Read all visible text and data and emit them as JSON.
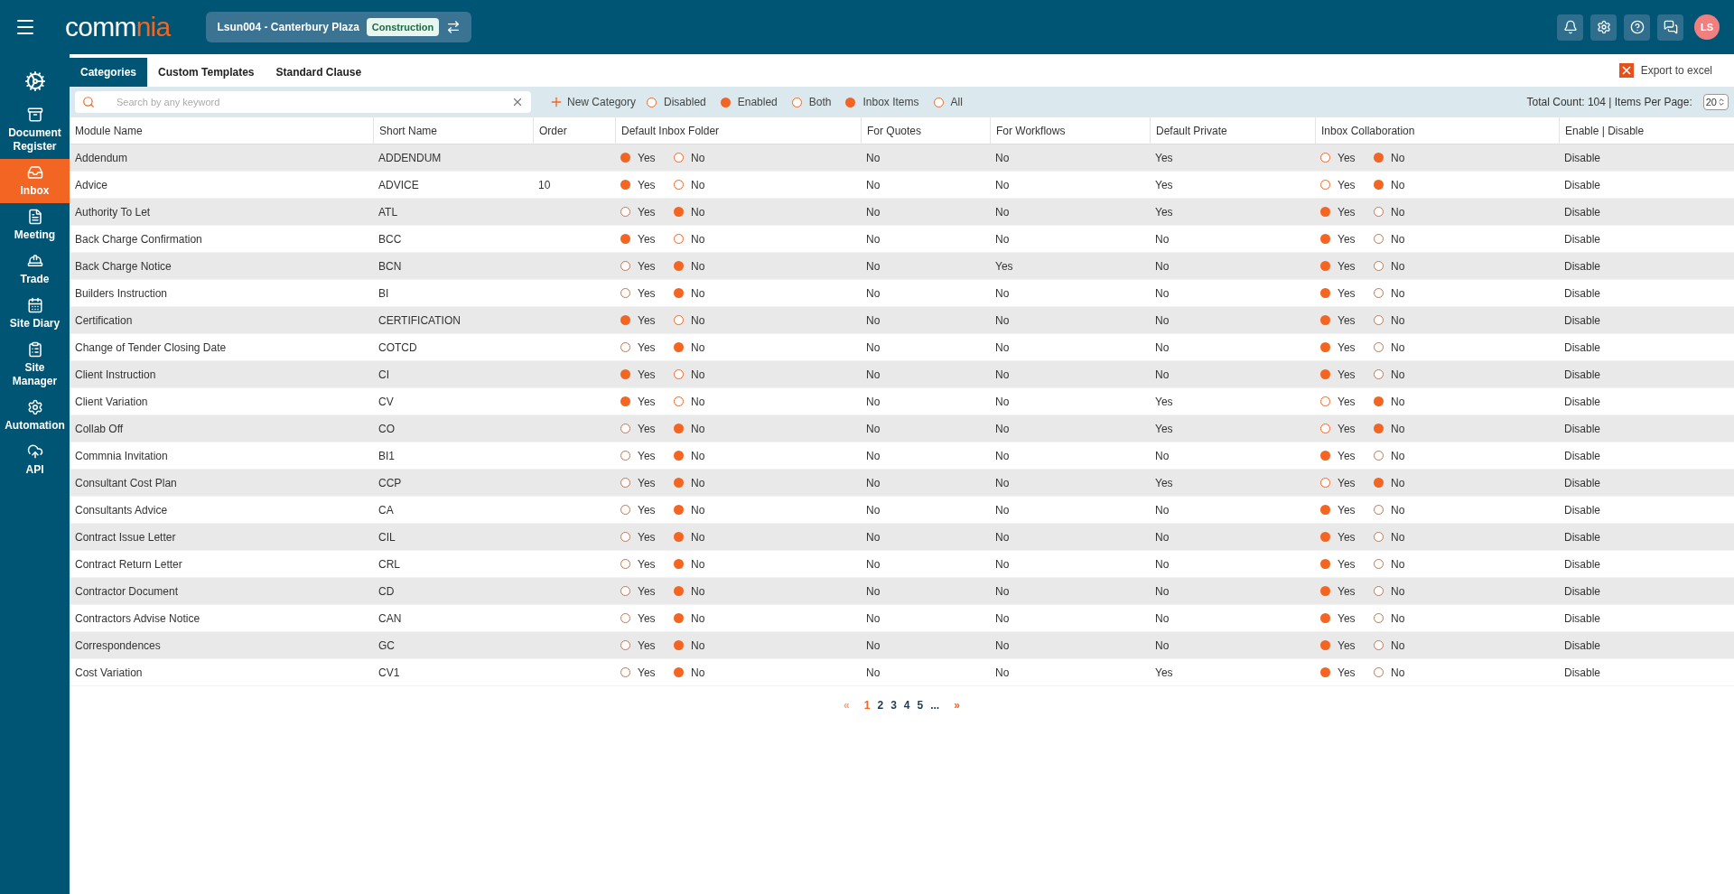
{
  "header": {
    "logo": {
      "main": "comm",
      "accent": "nia"
    },
    "project": {
      "name": "Lsun004 - Canterbury Plaza",
      "badge": "Construction"
    },
    "avatar": "LS"
  },
  "sidebar": {
    "items": [
      {
        "selected": false
      },
      {
        "label": "Document Register",
        "selected": false
      },
      {
        "label": "Inbox",
        "selected": true
      },
      {
        "label": "Meeting",
        "selected": false
      },
      {
        "label": "Trade",
        "selected": false
      },
      {
        "label": "Site Diary",
        "selected": false
      },
      {
        "label": "Site Manager",
        "selected": false
      },
      {
        "label": "Automation",
        "selected": false
      },
      {
        "label": "API",
        "selected": false
      }
    ]
  },
  "tabs": [
    {
      "label": "Categories",
      "selected": true
    },
    {
      "label": "Custom Templates",
      "selected": false
    },
    {
      "label": "Standard Clause",
      "selected": false
    }
  ],
  "export": "Export to excel",
  "search": {
    "placeholder": "Search by any keyword"
  },
  "new_category": "New Category",
  "filters": [
    [
      {
        "label": "Disabled",
        "selected": false
      },
      {
        "label": "Enabled",
        "selected": true
      },
      {
        "label": "Both",
        "selected": false
      }
    ],
    [
      {
        "label": "Inbox Items",
        "selected": true
      },
      {
        "label": "All",
        "selected": false
      }
    ]
  ],
  "total": "Total Count: 104 | Items Per Page:",
  "per_page": "20",
  "table": {
    "columns": [
      "Module Name",
      "Short Name",
      "Order",
      "Default Inbox Folder",
      "For Quotes",
      "For Workflows",
      "Default Private",
      "Inbox Collaboration",
      "Enable | Disable"
    ],
    "rows": [
      {
        "name": "Addendum",
        "short": "ADDENDUM",
        "inbox": [
          {
            "label": "Yes",
            "selected": true
          },
          {
            "label": "No",
            "selected": false
          }
        ],
        "quotes": "No",
        "workflows": "No",
        "private": "Yes",
        "collab": [
          {
            "label": "Yes",
            "selected": false
          },
          {
            "label": "No",
            "selected": true
          }
        ],
        "action": "Disable"
      },
      {
        "name": "Advice",
        "short": "ADVICE",
        "order": "10",
        "inbox": [
          {
            "label": "Yes",
            "selected": true
          },
          {
            "label": "No",
            "selected": false
          }
        ],
        "quotes": "No",
        "workflows": "No",
        "private": "Yes",
        "collab": [
          {
            "label": "Yes",
            "selected": false
          },
          {
            "label": "No",
            "selected": true
          }
        ],
        "action": "Disable"
      },
      {
        "name": "Authority To Let",
        "short": "ATL",
        "inbox": [
          {
            "label": "Yes",
            "selected": false
          },
          {
            "label": "No",
            "selected": true
          }
        ],
        "quotes": "No",
        "workflows": "No",
        "private": "Yes",
        "collab": [
          {
            "label": "Yes",
            "selected": true
          },
          {
            "label": "No",
            "selected": false
          }
        ],
        "action": "Disable"
      },
      {
        "name": "Back Charge Confirmation",
        "short": "BCC",
        "inbox": [
          {
            "label": "Yes",
            "selected": true
          },
          {
            "label": "No",
            "selected": false
          }
        ],
        "quotes": "No",
        "workflows": "No",
        "private": "No",
        "collab": [
          {
            "label": "Yes",
            "selected": true
          },
          {
            "label": "No",
            "selected": false
          }
        ],
        "action": "Disable"
      },
      {
        "name": "Back Charge Notice",
        "short": "BCN",
        "inbox": [
          {
            "label": "Yes",
            "selected": false
          },
          {
            "label": "No",
            "selected": true
          }
        ],
        "quotes": "No",
        "workflows": "Yes",
        "private": "No",
        "collab": [
          {
            "label": "Yes",
            "selected": true
          },
          {
            "label": "No",
            "selected": false
          }
        ],
        "action": "Disable"
      },
      {
        "name": "Builders Instruction",
        "short": "BI",
        "inbox": [
          {
            "label": "Yes",
            "selected": false
          },
          {
            "label": "No",
            "selected": true
          }
        ],
        "quotes": "No",
        "workflows": "No",
        "private": "No",
        "collab": [
          {
            "label": "Yes",
            "selected": true
          },
          {
            "label": "No",
            "selected": false
          }
        ],
        "action": "Disable"
      },
      {
        "name": "Certification",
        "short": "CERTIFICATION",
        "inbox": [
          {
            "label": "Yes",
            "selected": true
          },
          {
            "label": "No",
            "selected": false
          }
        ],
        "quotes": "No",
        "workflows": "No",
        "private": "No",
        "collab": [
          {
            "label": "Yes",
            "selected": true
          },
          {
            "label": "No",
            "selected": false
          }
        ],
        "action": "Disable"
      },
      {
        "name": "Change of Tender Closing Date",
        "short": "COTCD",
        "inbox": [
          {
            "label": "Yes",
            "selected": false
          },
          {
            "label": "No",
            "selected": true
          }
        ],
        "quotes": "No",
        "workflows": "No",
        "private": "No",
        "collab": [
          {
            "label": "Yes",
            "selected": true
          },
          {
            "label": "No",
            "selected": false
          }
        ],
        "action": "Disable"
      },
      {
        "name": "Client Instruction",
        "short": "CI",
        "inbox": [
          {
            "label": "Yes",
            "selected": true
          },
          {
            "label": "No",
            "selected": false
          }
        ],
        "quotes": "No",
        "workflows": "No",
        "private": "No",
        "collab": [
          {
            "label": "Yes",
            "selected": true
          },
          {
            "label": "No",
            "selected": false
          }
        ],
        "action": "Disable"
      },
      {
        "name": "Client Variation",
        "short": "CV",
        "inbox": [
          {
            "label": "Yes",
            "selected": true
          },
          {
            "label": "No",
            "selected": false
          }
        ],
        "quotes": "No",
        "workflows": "No",
        "private": "Yes",
        "collab": [
          {
            "label": "Yes",
            "selected": false
          },
          {
            "label": "No",
            "selected": true
          }
        ],
        "action": "Disable"
      },
      {
        "name": "Collab Off",
        "short": "CO",
        "inbox": [
          {
            "label": "Yes",
            "selected": false
          },
          {
            "label": "No",
            "selected": true
          }
        ],
        "quotes": "No",
        "workflows": "No",
        "private": "Yes",
        "collab": [
          {
            "label": "Yes",
            "selected": false
          },
          {
            "label": "No",
            "selected": true
          }
        ],
        "action": "Disable"
      },
      {
        "name": "Commnia Invitation",
        "short": "BI1",
        "inbox": [
          {
            "label": "Yes",
            "selected": false
          },
          {
            "label": "No",
            "selected": true
          }
        ],
        "quotes": "No",
        "workflows": "No",
        "private": "No",
        "collab": [
          {
            "label": "Yes",
            "selected": true
          },
          {
            "label": "No",
            "selected": false
          }
        ],
        "action": "Disable"
      },
      {
        "name": "Consultant Cost Plan",
        "short": "CCP",
        "inbox": [
          {
            "label": "Yes",
            "selected": false
          },
          {
            "label": "No",
            "selected": true
          }
        ],
        "quotes": "No",
        "workflows": "No",
        "private": "Yes",
        "collab": [
          {
            "label": "Yes",
            "selected": false
          },
          {
            "label": "No",
            "selected": true
          }
        ],
        "action": "Disable"
      },
      {
        "name": "Consultants Advice",
        "short": "CA",
        "inbox": [
          {
            "label": "Yes",
            "selected": false
          },
          {
            "label": "No",
            "selected": true
          }
        ],
        "quotes": "No",
        "workflows": "No",
        "private": "No",
        "collab": [
          {
            "label": "Yes",
            "selected": true
          },
          {
            "label": "No",
            "selected": false
          }
        ],
        "action": "Disable"
      },
      {
        "name": "Contract Issue Letter",
        "short": "CIL",
        "inbox": [
          {
            "label": "Yes",
            "selected": false
          },
          {
            "label": "No",
            "selected": true
          }
        ],
        "quotes": "No",
        "workflows": "No",
        "private": "No",
        "collab": [
          {
            "label": "Yes",
            "selected": true
          },
          {
            "label": "No",
            "selected": false
          }
        ],
        "action": "Disable"
      },
      {
        "name": "Contract Return Letter",
        "short": "CRL",
        "inbox": [
          {
            "label": "Yes",
            "selected": false
          },
          {
            "label": "No",
            "selected": true
          }
        ],
        "quotes": "No",
        "workflows": "No",
        "private": "No",
        "collab": [
          {
            "label": "Yes",
            "selected": true
          },
          {
            "label": "No",
            "selected": false
          }
        ],
        "action": "Disable"
      },
      {
        "name": "Contractor Document",
        "short": "CD",
        "inbox": [
          {
            "label": "Yes",
            "selected": false
          },
          {
            "label": "No",
            "selected": true
          }
        ],
        "quotes": "No",
        "workflows": "No",
        "private": "No",
        "collab": [
          {
            "label": "Yes",
            "selected": true
          },
          {
            "label": "No",
            "selected": false
          }
        ],
        "action": "Disable"
      },
      {
        "name": "Contractors Advise Notice",
        "short": "CAN",
        "inbox": [
          {
            "label": "Yes",
            "selected": false
          },
          {
            "label": "No",
            "selected": true
          }
        ],
        "quotes": "No",
        "workflows": "No",
        "private": "No",
        "collab": [
          {
            "label": "Yes",
            "selected": true
          },
          {
            "label": "No",
            "selected": false
          }
        ],
        "action": "Disable"
      },
      {
        "name": "Correspondences",
        "short": "GC",
        "inbox": [
          {
            "label": "Yes",
            "selected": false
          },
          {
            "label": "No",
            "selected": true
          }
        ],
        "quotes": "No",
        "workflows": "No",
        "private": "No",
        "collab": [
          {
            "label": "Yes",
            "selected": true
          },
          {
            "label": "No",
            "selected": false
          }
        ],
        "action": "Disable"
      },
      {
        "name": "Cost Variation",
        "short": "CV1",
        "inbox": [
          {
            "label": "Yes",
            "selected": false
          },
          {
            "label": "No",
            "selected": true
          }
        ],
        "quotes": "No",
        "workflows": "No",
        "private": "Yes",
        "collab": [
          {
            "label": "Yes",
            "selected": true
          },
          {
            "label": "No",
            "selected": false
          }
        ],
        "action": "Disable"
      }
    ]
  },
  "pagination": {
    "prev": "«",
    "pages": [
      {
        "label": "1",
        "selected": true
      },
      {
        "label": "2",
        "selected": false
      },
      {
        "label": "3",
        "selected": false
      },
      {
        "label": "4",
        "selected": false
      },
      {
        "label": "5",
        "selected": false
      },
      {
        "label": "...",
        "selected": false
      }
    ],
    "next": "»"
  }
}
